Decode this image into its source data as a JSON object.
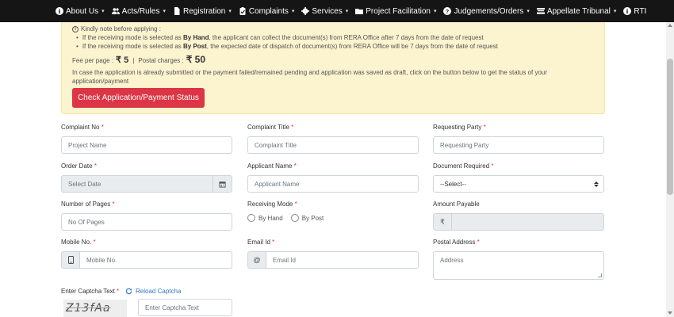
{
  "nav": {
    "items": [
      {
        "label": "About Us",
        "icon": "info-circle-icon"
      },
      {
        "label": "Acts/Rules",
        "icon": "users-icon"
      },
      {
        "label": "Registration",
        "icon": "file-icon"
      },
      {
        "label": "Complaints",
        "icon": "clipboard-icon"
      },
      {
        "label": "Services",
        "icon": "gears-icon"
      },
      {
        "label": "Project Facilitation",
        "icon": "folder-icon"
      },
      {
        "label": "Judgements/Orders",
        "icon": "question-circle-icon"
      },
      {
        "label": "Appellate Tribunal",
        "icon": "tribunal-icon"
      },
      {
        "label": "RTI",
        "icon": "info-circle-icon"
      }
    ]
  },
  "notice": {
    "heading": "Kindly note before applying :",
    "bullets": [
      {
        "pre": "If the receiving mode is selected as ",
        "bold": "By Hand",
        "post": ", the applicant can collect the document(s) from RERA Office after 7 days from the date of request"
      },
      {
        "pre": "If the receiving mode is selected as ",
        "bold": "By Post",
        "post": ", the expected date of dispatch of document(s) from RERA Office will be 7 days from the date of request"
      }
    ],
    "fee_label": "Fee per page :",
    "fee_amount": "₹ 5",
    "separator": "|",
    "postal_label": "Postal charges :",
    "postal_amount": "₹ 50",
    "paragraph": "In case the application is already submitted or the payment failed/remained pending and application was saved as draft, click on the button below to get the status of your application/payment",
    "button": "Check Application/Payment Status"
  },
  "form": {
    "complaint_no": {
      "label": "Complaint No",
      "placeholder": "Project Name"
    },
    "complaint_title": {
      "label": "Complaint Title",
      "placeholder": "Complaint Title"
    },
    "requesting_party": {
      "label": "Requesting Party",
      "placeholder": "Requesting Party"
    },
    "order_date": {
      "label": "Order Date",
      "placeholder": "Select Date"
    },
    "applicant_name": {
      "label": "Applicant Name",
      "placeholder": "Applicant Name"
    },
    "document_required": {
      "label": "Document Required",
      "selected": "--Select--"
    },
    "number_of_pages": {
      "label": "Number of Pages",
      "placeholder": "No Of Pages"
    },
    "receiving_mode": {
      "label": "Receiving Mode",
      "options": [
        "By Hand",
        "By Post"
      ]
    },
    "amount_payable": {
      "label": "Amount Payable",
      "currency": "₹"
    },
    "mobile_no": {
      "label": "Mobile No.",
      "placeholder": "Mobile No."
    },
    "email_id": {
      "label": "Email Id",
      "placeholder": "Email Id",
      "addon": "@"
    },
    "postal_address": {
      "label": "Postal Address",
      "placeholder": "Address"
    },
    "captcha": {
      "label": "Enter Captcha Text",
      "reload": "Reload Captcha",
      "image_text": "Z13fAa",
      "placeholder": "Enter Captcha Text"
    },
    "required_mark": "*"
  },
  "colors": {
    "nav_bg": "#151515",
    "notice_bg": "#fcf3cf",
    "danger": "#dc3545",
    "link": "#2e7bcf"
  }
}
